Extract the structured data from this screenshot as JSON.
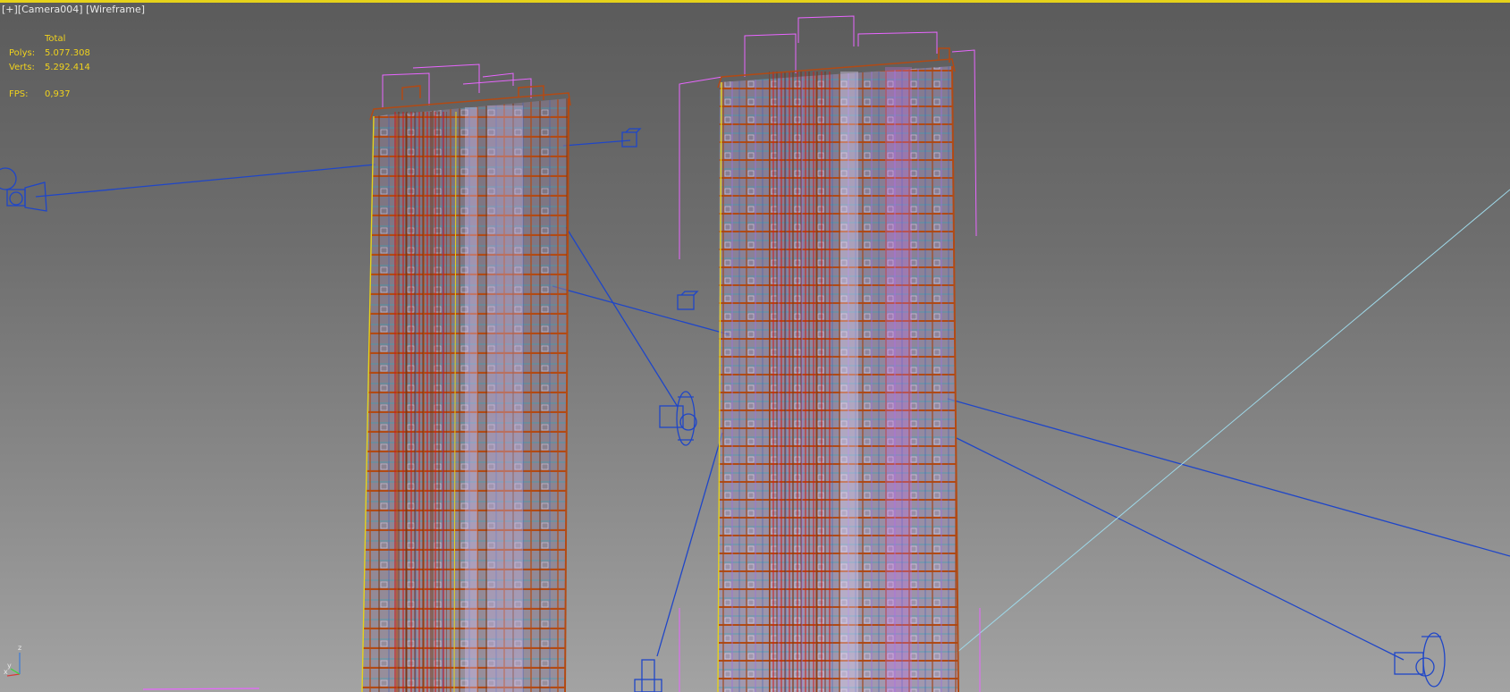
{
  "viewport": {
    "menu_label": "[+]",
    "camera_label": "[Camera004]",
    "shading_label": "[Wireframe]",
    "colors": {
      "frame_active": "#e6d21a",
      "stats_text": "#f0d21c",
      "light_wire": "#1f46c8",
      "brick_wire": "#b24a14",
      "red_wire": "#cc1a1a",
      "cyan_wire": "#2aa6b8",
      "pink_wire": "#e866ff",
      "lavender_fill": "#c9b8ea"
    }
  },
  "stats": {
    "total_header": "Total",
    "polys_label": "Polys:",
    "polys_value": "5.077.308",
    "verts_label": "Verts:",
    "verts_value": "5.292.414",
    "fps_label": "FPS:",
    "fps_value": "0,937"
  },
  "axis_gizmo": {
    "z_label": "z",
    "x_label": "x",
    "y_label": "y"
  },
  "scene_objects": [
    {
      "name": "tower-left",
      "type": "building-wireframe"
    },
    {
      "name": "tower-right",
      "type": "building-wireframe"
    },
    {
      "name": "light-01",
      "type": "target-light-icon"
    },
    {
      "name": "light-02",
      "type": "target-light-icon"
    },
    {
      "name": "light-03",
      "type": "target-light-icon"
    },
    {
      "name": "light-04",
      "type": "target-light-icon"
    },
    {
      "name": "light-05",
      "type": "target-light-icon"
    }
  ]
}
